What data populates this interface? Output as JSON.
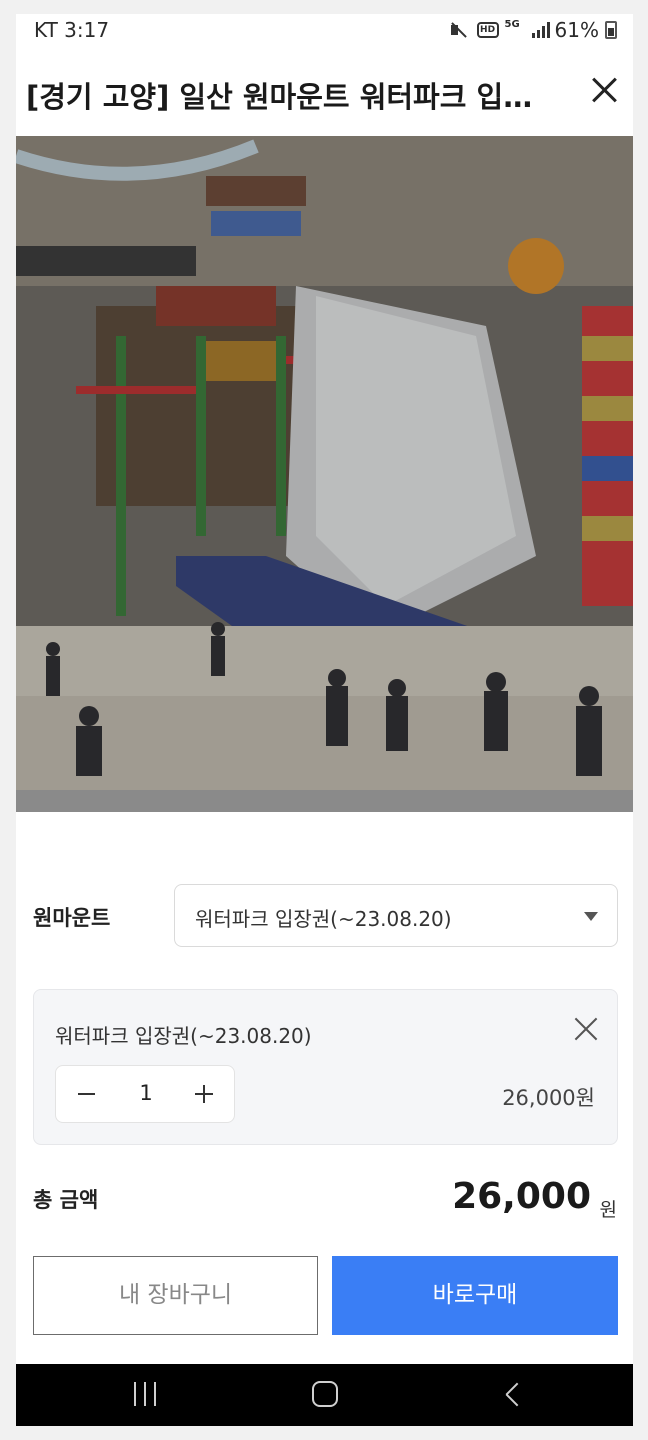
{
  "status_bar": {
    "carrier_time": "KT 3:17",
    "network_label": "5G",
    "battery": "61%",
    "icons": [
      "mute-icon",
      "hd-icon",
      "5g-icon",
      "signal-icon",
      "battery-icon"
    ]
  },
  "header": {
    "title": "[경기 고양] 일산 원마운트 워터파크 입장권",
    "close_icon": "close-icon"
  },
  "product": {
    "option_label": "원마운트",
    "selected_option": "워터파크 입장권(~23.08.20)"
  },
  "selected_item": {
    "name": "워터파크 입장권(~23.08.20)",
    "quantity": "1",
    "price": "26,000원"
  },
  "total": {
    "label": "총 금액",
    "amount": "26,000",
    "unit": "원"
  },
  "actions": {
    "cart_label": "내 장바구니",
    "buy_label": "바로구매"
  },
  "colors": {
    "accent": "#3a7ef5",
    "overlay_dim": "#000000"
  }
}
